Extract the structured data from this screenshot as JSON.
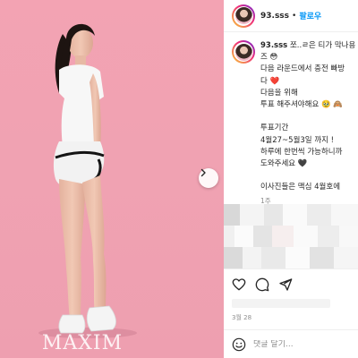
{
  "post": {
    "watermark": "MAXIM",
    "image_alt": "photo"
  },
  "header": {
    "username": "93.sss",
    "separator": "•",
    "follow_label": "팔로우"
  },
  "caption": {
    "username": "93.sss",
    "line1_rest": " 쪼..ㄹ은 티가 막나용",
    "lines": [
      "즈 😳",
      "다음 라운드에서 충전 빠방",
      "다 ❤️",
      "다음을 위해",
      "투표 해주셔야해요 🥹 🙈",
      "",
      "투표기간",
      "4월27~5월3일 까지 !",
      "하루에 한번씩 가능하니까",
      "도와주세요 🖤",
      "",
      "이사진들은 맥심 4월호에"
    ],
    "time_ago": "1주"
  },
  "date": "3월 28",
  "comment_placeholder": "댓글 달기...",
  "colors": {
    "follow": "#0095f6",
    "background_photo": "#f0a2b2"
  }
}
